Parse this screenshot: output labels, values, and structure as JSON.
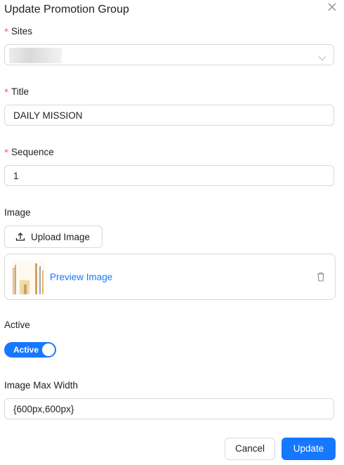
{
  "dialog": {
    "title": "Update Promotion Group",
    "close_icon": "close-icon"
  },
  "form": {
    "sites": {
      "label": "Sites",
      "required": true,
      "required_mark": "*",
      "value": ""
    },
    "title": {
      "label": "Title",
      "required": true,
      "required_mark": "*",
      "value": "DAILY MISSION"
    },
    "sequence": {
      "label": "Sequence",
      "required": true,
      "required_mark": "*",
      "value": "1"
    },
    "image": {
      "label": "Image",
      "upload_label": "Upload Image",
      "preview_label": "Preview Image"
    },
    "active": {
      "label": "Active",
      "switch_text": "Active",
      "on": true
    },
    "image_max_width": {
      "label": "Image Max Width",
      "value": "{600px,600px}"
    }
  },
  "footer": {
    "cancel_label": "Cancel",
    "update_label": "Update"
  },
  "colors": {
    "primary": "#1677ff",
    "required": "#ff4d4f",
    "border": "#d9d9d9"
  }
}
